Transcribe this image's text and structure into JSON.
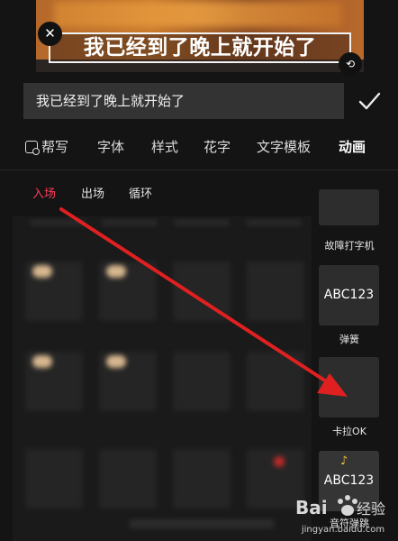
{
  "preview": {
    "subtitle": "我已经到了晚上就开始了"
  },
  "editor": {
    "input_value": "我已经到了晚上就开始了",
    "confirm_icon": "checkmark-icon"
  },
  "tabs": [
    {
      "label": "帮写",
      "icon": "ai-write-icon",
      "active": false
    },
    {
      "label": "字体",
      "active": false
    },
    {
      "label": "样式",
      "active": false
    },
    {
      "label": "花字",
      "active": false
    },
    {
      "label": "文字模板",
      "active": false
    },
    {
      "label": "动画",
      "active": true
    }
  ],
  "subtabs": [
    {
      "label": "入场",
      "active": true
    },
    {
      "label": "出场",
      "active": false
    },
    {
      "label": "循环",
      "active": false
    }
  ],
  "effects": [
    {
      "label": "故障打字机",
      "thumb_text": ""
    },
    {
      "label": "弹簧",
      "thumb_text": "ABC123"
    },
    {
      "label": "卡拉OK",
      "thumb_text": ""
    },
    {
      "label": "音符弹跳",
      "thumb_text": "ABC123"
    }
  ],
  "colors": {
    "accent": "#ff3d5a",
    "annotation_arrow": "#e02020",
    "background": "#141414"
  },
  "watermark": {
    "brand": "Bai",
    "brand2": "经验",
    "url": "jingyan.baidu.com"
  }
}
